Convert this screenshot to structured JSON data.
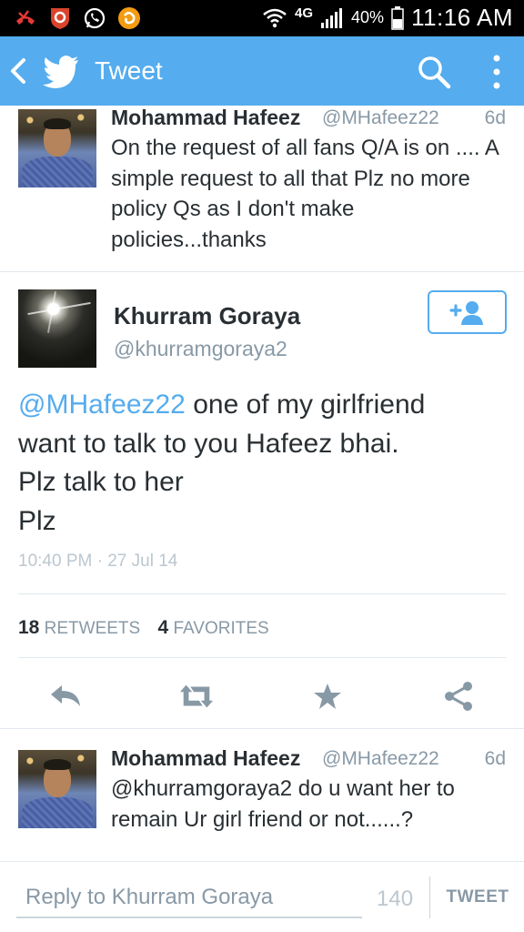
{
  "status_bar": {
    "network": "4G",
    "battery": "40%",
    "time": "11:16 AM"
  },
  "app_bar": {
    "title": "Tweet",
    "accent_color": "#55acee"
  },
  "tweets_above": [
    {
      "name": "Mohammad Hafeez",
      "handle": "@MHafeez22",
      "age": "6d",
      "text": "On the request of all fans Q/A is on .... A simple request to all that Plz no more policy Qs as I don't make policies...thanks"
    }
  ],
  "focused_tweet": {
    "name": "Khurram Goraya",
    "handle": "@khurramgoraya2",
    "mention": "@MHafeez22",
    "text_line1_rest": " one of my girlfriend",
    "text_line2": "want to talk to you Hafeez bhai.",
    "text_line3": "Plz talk to her",
    "text_line4": "Plz",
    "timestamp": "10:40 PM · 27 Jul 14",
    "retweets_count": "18",
    "retweets_label": "RETWEETS",
    "favorites_count": "4",
    "favorites_label": "FAVORITES"
  },
  "actions": {
    "reply_icon": "reply-icon",
    "retweet_icon": "retweet-icon",
    "favorite_icon": "star-icon",
    "share_icon": "share-icon"
  },
  "replies": [
    {
      "name": "Mohammad Hafeez",
      "handle": "@MHafeez22",
      "age": "6d",
      "text": "@khurramgoraya2 do u want her to remain Ur girl friend or not......?"
    }
  ],
  "reply_bar": {
    "placeholder": "Reply to Khurram Goraya",
    "char_count": "140",
    "tweet_label": "TWEET"
  }
}
